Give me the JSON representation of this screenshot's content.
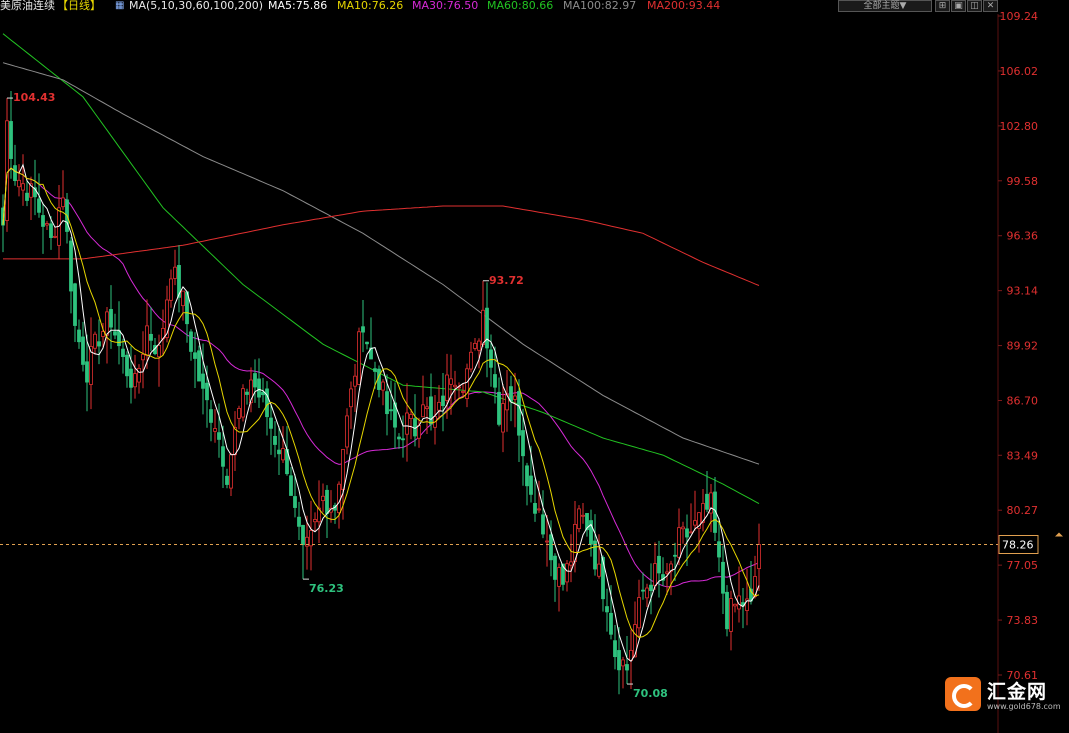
{
  "header": {
    "instrument": "美原油连续",
    "period": "【日线】",
    "ma_spec": "MA(5,10,30,60,100,200)",
    "ma_values": [
      {
        "label": "MA5:75.86",
        "color": "#ffffff"
      },
      {
        "label": "MA10:76.26",
        "color": "#e6d600"
      },
      {
        "label": "MA30:76.50",
        "color": "#d62ad6"
      },
      {
        "label": "MA60:80.66",
        "color": "#22c322"
      },
      {
        "label": "MA100:82.97",
        "color": "#8c8c8c"
      },
      {
        "label": "MA200:93.44",
        "color": "#e03030"
      }
    ],
    "theme_button": "全部主题▼"
  },
  "logo": {
    "name": "汇金网",
    "url": "www.gold678.com"
  },
  "colors": {
    "up": "#e03030",
    "down": "#2ec27e",
    "axis_text": "#e03030",
    "price_line": "#e0a050"
  },
  "chart_data": {
    "type": "candlestick",
    "ylim": [
      69.0,
      109.24
    ],
    "y_ticks": [
      109.24,
      106.02,
      102.8,
      99.58,
      96.36,
      93.14,
      89.92,
      86.7,
      83.49,
      80.27,
      77.05,
      73.83,
      70.61
    ],
    "last_price": 78.26,
    "annotations": [
      {
        "label": "104.43",
        "index": 1,
        "value": 104.43,
        "type": "high"
      },
      {
        "label": "93.72",
        "index": 120,
        "value": 93.72,
        "type": "high"
      },
      {
        "label": "76.23",
        "index": 75,
        "value": 76.23,
        "type": "low"
      },
      {
        "label": "70.08",
        "index": 156,
        "value": 70.08,
        "type": "low"
      }
    ],
    "close_keyframes": [
      [
        0,
        97.0
      ],
      [
        1,
        103.0
      ],
      [
        3,
        100.0
      ],
      [
        8,
        98.5
      ],
      [
        12,
        96.0
      ],
      [
        15,
        99.0
      ],
      [
        18,
        91.0
      ],
      [
        21,
        88.5
      ],
      [
        24,
        90.5
      ],
      [
        27,
        91.5
      ],
      [
        30,
        89.0
      ],
      [
        33,
        87.5
      ],
      [
        36,
        91.0
      ],
      [
        39,
        89.5
      ],
      [
        42,
        94.5
      ],
      [
        45,
        92.5
      ],
      [
        47,
        90.0
      ],
      [
        50,
        87.0
      ],
      [
        53,
        85.5
      ],
      [
        56,
        82.5
      ],
      [
        59,
        86.0
      ],
      [
        62,
        88.0
      ],
      [
        65,
        86.5
      ],
      [
        68,
        84.5
      ],
      [
        71,
        83.0
      ],
      [
        73,
        80.0
      ],
      [
        75,
        77.5
      ],
      [
        77,
        78.5
      ],
      [
        80,
        81.0
      ],
      [
        83,
        80.5
      ],
      [
        85,
        84.0
      ],
      [
        87,
        87.0
      ],
      [
        90,
        91.5
      ],
      [
        92,
        89.0
      ],
      [
        94,
        88.0
      ],
      [
        96,
        86.0
      ],
      [
        99,
        84.5
      ],
      [
        101,
        85.5
      ],
      [
        103,
        85.0
      ],
      [
        105,
        87.0
      ],
      [
        107,
        85.0
      ],
      [
        109,
        86.0
      ],
      [
        112,
        88.5
      ],
      [
        115,
        88.0
      ],
      [
        118,
        89.5
      ],
      [
        120,
        92.0
      ],
      [
        122,
        89.0
      ],
      [
        124,
        86.0
      ],
      [
        126,
        87.5
      ],
      [
        128,
        86.5
      ],
      [
        130,
        84.0
      ],
      [
        132,
        81.0
      ],
      [
        134,
        80.5
      ],
      [
        137,
        77.5
      ],
      [
        140,
        76.0
      ],
      [
        142,
        77.5
      ],
      [
        144,
        80.0
      ],
      [
        146,
        79.5
      ],
      [
        149,
        76.5
      ],
      [
        151,
        75.0
      ],
      [
        153,
        72.0
      ],
      [
        156,
        71.0
      ],
      [
        158,
        73.5
      ],
      [
        160,
        75.5
      ],
      [
        163,
        76.5
      ],
      [
        166,
        76.0
      ],
      [
        169,
        78.5
      ],
      [
        172,
        79.0
      ],
      [
        175,
        80.0
      ],
      [
        177,
        80.5
      ],
      [
        179,
        77.0
      ],
      [
        181,
        74.0
      ],
      [
        184,
        75.0
      ],
      [
        187,
        74.5
      ],
      [
        189,
        78.26
      ]
    ],
    "series": [
      {
        "name": "MA5",
        "period": 5,
        "color": "#ffffff"
      },
      {
        "name": "MA10",
        "period": 10,
        "color": "#e6d600"
      },
      {
        "name": "MA30",
        "period": 30,
        "color": "#d62ad6"
      },
      {
        "name": "MA60",
        "period": 60,
        "color": "#22c322",
        "points": [
          [
            0,
            108.2
          ],
          [
            20,
            104.5
          ],
          [
            40,
            98.0
          ],
          [
            60,
            93.5
          ],
          [
            80,
            90.0
          ],
          [
            100,
            87.6
          ],
          [
            120,
            87.2
          ],
          [
            135,
            86.0
          ],
          [
            150,
            84.5
          ],
          [
            165,
            83.5
          ],
          [
            180,
            81.8
          ],
          [
            189,
            80.66
          ]
        ]
      },
      {
        "name": "MA100",
        "period": 100,
        "color": "#8c8c8c",
        "points": [
          [
            0,
            106.5
          ],
          [
            15,
            105.5
          ],
          [
            30,
            103.5
          ],
          [
            50,
            101.0
          ],
          [
            70,
            99.0
          ],
          [
            90,
            96.5
          ],
          [
            110,
            93.5
          ],
          [
            130,
            90.0
          ],
          [
            150,
            87.0
          ],
          [
            170,
            84.5
          ],
          [
            189,
            82.97
          ]
        ]
      },
      {
        "name": "MA200",
        "period": 200,
        "color": "#e03030",
        "points": [
          [
            0,
            95.0
          ],
          [
            20,
            95.0
          ],
          [
            45,
            95.8
          ],
          [
            70,
            97.0
          ],
          [
            90,
            97.8
          ],
          [
            110,
            98.1
          ],
          [
            125,
            98.1
          ],
          [
            145,
            97.3
          ],
          [
            160,
            96.5
          ],
          [
            175,
            94.8
          ],
          [
            189,
            93.44
          ]
        ]
      }
    ]
  }
}
